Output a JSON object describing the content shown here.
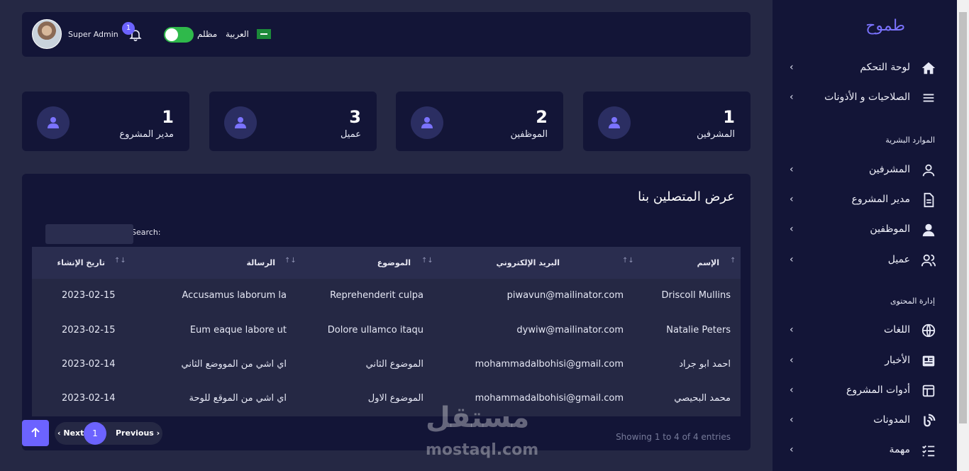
{
  "header": {
    "admin_name": "Super Admin",
    "notification_count": "1",
    "dark_mode_label": "مظلم",
    "language_label": "العربية"
  },
  "stats": [
    {
      "value": "1",
      "label": "المشرفين"
    },
    {
      "value": "2",
      "label": "الموظفين"
    },
    {
      "value": "3",
      "label": "عميل"
    },
    {
      "value": "1",
      "label": "مدير المشروع"
    }
  ],
  "table": {
    "title": "عرض المتصلين بنا",
    "search_label": "Search:",
    "columns": [
      "الإسم",
      "البريد الإلكتروني",
      "الموضوع",
      "الرسالة",
      "تاريخ الإنشاء"
    ],
    "rows": [
      {
        "name": "Driscoll Mullins",
        "email": "piwavun@mailinator.com",
        "subject": "Reprehenderit culpa",
        "message": "Accusamus laborum la",
        "date": "2023-02-15"
      },
      {
        "name": "Natalie Peters",
        "email": "dywiw@mailinator.com",
        "subject": "Dolore ullamco itaqu",
        "message": "Eum eaque labore ut",
        "date": "2023-02-15"
      },
      {
        "name": "احمد ابو جراد",
        "email": "mohammadalbohisi@gmail.com",
        "subject": "الموضوع الثاني",
        "message": "اي اشي من المووضع الثاني",
        "date": "2023-02-14"
      },
      {
        "name": "محمد البحيصي",
        "email": "mohammadalbohisi@gmail.com",
        "subject": "الموضوع الاول",
        "message": "اي اشي من الموقع للوحة",
        "date": "2023-02-14"
      }
    ],
    "info": "Showing 1 to 4 of 4 entries",
    "pagination": {
      "next": "Next",
      "page": "1",
      "previous": "Previous"
    }
  },
  "watermark": {
    "arabic": "مستقل",
    "latin": "mostaql.com"
  },
  "sidebar": {
    "brand": "طموح",
    "top_items": [
      {
        "label": "لوحة التحكم",
        "icon": "home-icon"
      },
      {
        "label": "الصلاحيات و الأذونات",
        "icon": "menu-icon"
      }
    ],
    "section_hr": "الموارد البشرية",
    "hr_items": [
      {
        "label": "المشرفين",
        "icon": "user-outline-icon"
      },
      {
        "label": "مدير المشروع",
        "icon": "document-icon"
      },
      {
        "label": "الموظفين",
        "icon": "user-icon"
      },
      {
        "label": "عميل",
        "icon": "users-icon"
      }
    ],
    "section_content": "إدارة المحتوى",
    "content_items": [
      {
        "label": "اللغات",
        "icon": "globe-icon"
      },
      {
        "label": "الأخبار",
        "icon": "newspaper-icon"
      },
      {
        "label": "أدوات المشروع",
        "icon": "layout-icon"
      },
      {
        "label": "المدونات",
        "icon": "blog-icon"
      },
      {
        "label": "مهمة",
        "icon": "tasks-icon"
      }
    ]
  }
}
